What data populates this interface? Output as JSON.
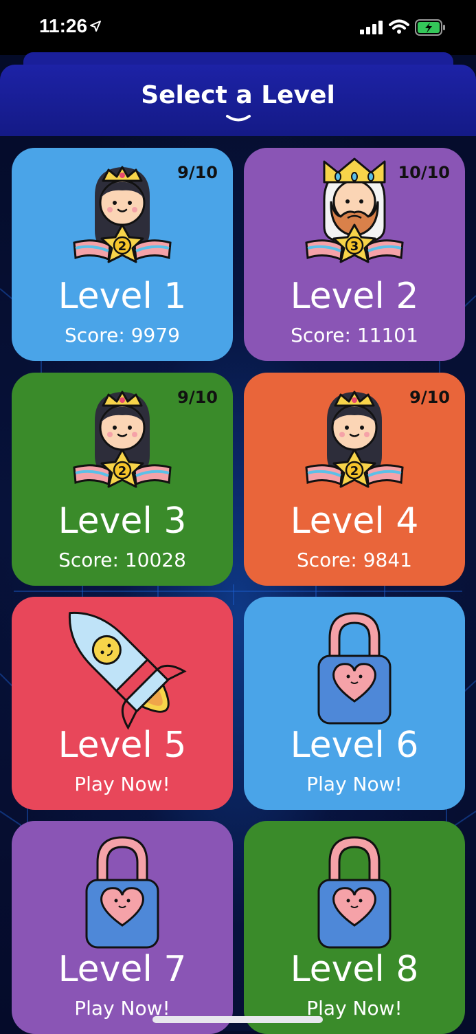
{
  "status_bar": {
    "time": "11:26"
  },
  "header": {
    "title": "Select a Level"
  },
  "levels": [
    {
      "title": "Level 1",
      "subtitle": "Score: 9979",
      "badge": "9/10",
      "color": "#4aa4e8",
      "icon": "princess-medal-2"
    },
    {
      "title": "Level 2",
      "subtitle": "Score: 11101",
      "badge": "10/10",
      "color": "#8a55b5",
      "icon": "king-medal-3"
    },
    {
      "title": "Level 3",
      "subtitle": "Score: 10028",
      "badge": "9/10",
      "color": "#3a8b2a",
      "icon": "princess-medal-2"
    },
    {
      "title": "Level 4",
      "subtitle": "Score: 9841",
      "badge": "9/10",
      "color": "#e9653a",
      "icon": "princess-medal-2"
    },
    {
      "title": "Level 5",
      "subtitle": "Play Now!",
      "badge": "",
      "color": "#e8475a",
      "icon": "rocket"
    },
    {
      "title": "Level 6",
      "subtitle": "Play Now!",
      "badge": "",
      "color": "#4aa4e8",
      "icon": "padlock-heart"
    },
    {
      "title": "Level 7",
      "subtitle": "Play Now!",
      "badge": "",
      "color": "#8a55b5",
      "icon": "padlock-heart"
    },
    {
      "title": "Level 8",
      "subtitle": "Play Now!",
      "badge": "",
      "color": "#3a8b2a",
      "icon": "padlock-heart"
    }
  ]
}
